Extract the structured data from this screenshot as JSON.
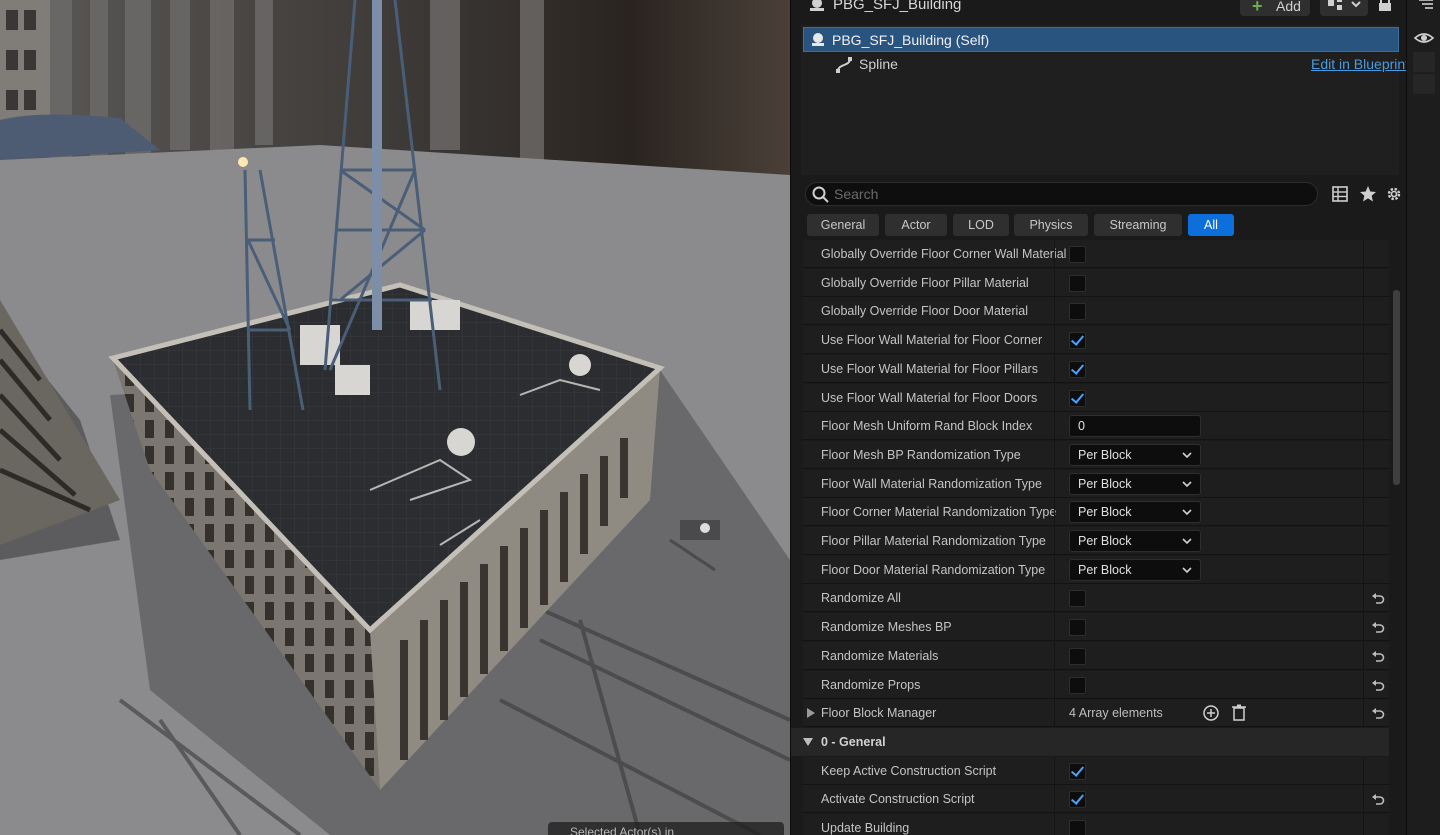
{
  "component_panel": {
    "title": "PBG_SFJ_Building",
    "add_label": "Add",
    "tree": [
      {
        "label": "PBG_SFJ_Building (Self)",
        "icon": "actor-icon",
        "selected": true
      },
      {
        "label": "Spline",
        "icon": "spline-icon",
        "selected": false
      }
    ],
    "edit_blueprint_link": "Edit in Blueprint"
  },
  "details": {
    "search_placeholder": "Search",
    "tabs": [
      {
        "label": "General",
        "active": false
      },
      {
        "label": "Actor",
        "active": false
      },
      {
        "label": "LOD",
        "active": false
      },
      {
        "label": "Physics",
        "active": false
      },
      {
        "label": "Streaming",
        "active": false
      },
      {
        "label": "All",
        "active": true
      }
    ],
    "properties": [
      {
        "name": "Globally Override Floor Corner Wall Material",
        "type": "checkbox",
        "checked": false
      },
      {
        "name": "Globally Override Floor Pillar Material",
        "type": "checkbox",
        "checked": false
      },
      {
        "name": "Globally Override Floor Door Material",
        "type": "checkbox",
        "checked": false
      },
      {
        "name": "Use Floor Wall Material for Floor Corner",
        "type": "checkbox",
        "checked": true
      },
      {
        "name": "Use Floor Wall Material for Floor Pillars",
        "type": "checkbox",
        "checked": true
      },
      {
        "name": "Use Floor Wall Material for Floor Doors",
        "type": "checkbox",
        "checked": true
      },
      {
        "name": "Floor Mesh Uniform Rand Block Index",
        "type": "number",
        "value": "0"
      },
      {
        "name": "Floor Mesh BP Randomization Type",
        "type": "dropdown",
        "value": "Per Block"
      },
      {
        "name": "Floor Wall Material Randomization Type",
        "type": "dropdown",
        "value": "Per Block"
      },
      {
        "name": "Floor Corner Material Randomization Type",
        "type": "dropdown",
        "value": "Per Block"
      },
      {
        "name": "Floor Pillar Material Randomization Type",
        "type": "dropdown",
        "value": "Per Block"
      },
      {
        "name": "Floor Door Material Randomization Type",
        "type": "dropdown",
        "value": "Per Block"
      },
      {
        "name": "Randomize All",
        "type": "checkbox",
        "checked": false,
        "reset": true
      },
      {
        "name": "Randomize Meshes BP",
        "type": "checkbox",
        "checked": false,
        "reset": true
      },
      {
        "name": "Randomize Materials",
        "type": "checkbox",
        "checked": false,
        "reset": true
      },
      {
        "name": "Randomize Props",
        "type": "checkbox",
        "checked": false,
        "reset": true
      },
      {
        "name": "Floor Block Manager",
        "type": "array",
        "value": "4 Array elements",
        "reset": true
      },
      {
        "name": "0 - General",
        "type": "section"
      },
      {
        "name": "Keep Active Construction Script",
        "type": "checkbox",
        "checked": true
      },
      {
        "name": "Activate Construction Script",
        "type": "checkbox",
        "checked": true,
        "reset": true
      },
      {
        "name": "Update Building",
        "type": "checkbox",
        "checked": false
      }
    ]
  },
  "viewport": {
    "status_text": "Selected Actor(s) in"
  },
  "colors": {
    "accent": "#0d6fdc",
    "selection": "#2a5480",
    "checkmark": "#4aa3ff",
    "link": "#4a9be0"
  }
}
